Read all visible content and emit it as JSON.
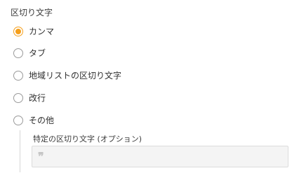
{
  "section": {
    "title": "区切り文字"
  },
  "options": [
    {
      "label": "カンマ",
      "checked": true
    },
    {
      "label": "タブ",
      "checked": false
    },
    {
      "label": "地域リストの区切り文字",
      "checked": false
    },
    {
      "label": "改行",
      "checked": false
    },
    {
      "label": "その他",
      "checked": false
    }
  ],
  "custom": {
    "label": "特定の区切り文字 (オプション)",
    "value": "",
    "placeholder_icon": "quote-icon",
    "placeholder_glyph": "❞"
  },
  "colors": {
    "accent": "#f59f1c",
    "input_bg": "#f4f4f4"
  }
}
